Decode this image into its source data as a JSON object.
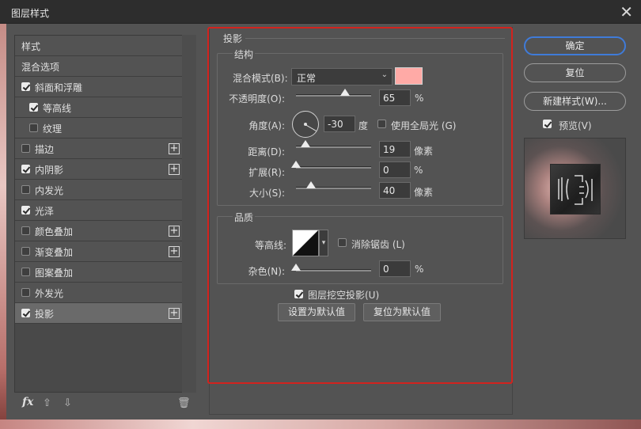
{
  "window": {
    "title": "图层样式"
  },
  "styles": [
    {
      "label": "样式",
      "checkbox": false,
      "checked": false,
      "plus": false,
      "indent": 0,
      "selected": false
    },
    {
      "label": "混合选项",
      "checkbox": false,
      "checked": false,
      "plus": false,
      "indent": 0,
      "selected": false
    },
    {
      "label": "斜面和浮雕",
      "checkbox": true,
      "checked": true,
      "plus": false,
      "indent": 0,
      "selected": false
    },
    {
      "label": "等高线",
      "checkbox": true,
      "checked": true,
      "plus": false,
      "indent": 1,
      "selected": false
    },
    {
      "label": "纹理",
      "checkbox": true,
      "checked": false,
      "plus": false,
      "indent": 1,
      "selected": false
    },
    {
      "label": "描边",
      "checkbox": true,
      "checked": false,
      "plus": true,
      "indent": 0,
      "selected": false
    },
    {
      "label": "内阴影",
      "checkbox": true,
      "checked": true,
      "plus": true,
      "indent": 0,
      "selected": false
    },
    {
      "label": "内发光",
      "checkbox": true,
      "checked": false,
      "plus": false,
      "indent": 0,
      "selected": false
    },
    {
      "label": "光泽",
      "checkbox": true,
      "checked": true,
      "plus": false,
      "indent": 0,
      "selected": false
    },
    {
      "label": "颜色叠加",
      "checkbox": true,
      "checked": false,
      "plus": true,
      "indent": 0,
      "selected": false
    },
    {
      "label": "渐变叠加",
      "checkbox": true,
      "checked": false,
      "plus": true,
      "indent": 0,
      "selected": false
    },
    {
      "label": "图案叠加",
      "checkbox": true,
      "checked": false,
      "plus": false,
      "indent": 0,
      "selected": false
    },
    {
      "label": "外发光",
      "checkbox": true,
      "checked": false,
      "plus": false,
      "indent": 0,
      "selected": false
    },
    {
      "label": "投影",
      "checkbox": true,
      "checked": true,
      "plus": true,
      "indent": 0,
      "selected": true
    }
  ],
  "toolbar": {
    "fx": "fx",
    "up": "⇧",
    "down": "⇩",
    "trash": "🗑"
  },
  "panel": {
    "title": "投影",
    "structure": {
      "title": "结构",
      "blend_label": "混合模式(B):",
      "blend_value": "正常",
      "blend_color": "#ffaaa6",
      "opacity_label": "不透明度(O):",
      "opacity_value": "65",
      "opacity_unit": "%",
      "opacity_level": 0.65,
      "angle_label": "角度(A):",
      "angle_value": "-30",
      "angle_unit": "度",
      "global_light_label": "使用全局光 (G)",
      "global_light_checked": false,
      "distance_label": "距离(D):",
      "distance_value": "19",
      "distance_unit": "像素",
      "distance_level": 0.13,
      "spread_label": "扩展(R):",
      "spread_value": "0",
      "spread_unit": "%",
      "spread_level": 0,
      "size_label": "大小(S):",
      "size_value": "40",
      "size_unit": "像素",
      "size_level": 0.2
    },
    "quality": {
      "title": "品质",
      "contour_label": "等高线:",
      "antialias_label": "消除锯齿 (L)",
      "antialias_checked": false,
      "noise_label": "杂色(N):",
      "noise_value": "0",
      "noise_unit": "%",
      "noise_level": 0
    },
    "knockout_label": "图层挖空投影(U)",
    "knockout_checked": true,
    "set_default": "设置为默认值",
    "reset_default": "复位为默认值"
  },
  "buttons": {
    "ok": "确定",
    "reset": "复位",
    "new_style": "新建样式(W)...",
    "preview_label": "预览(V)",
    "preview_checked": true
  }
}
